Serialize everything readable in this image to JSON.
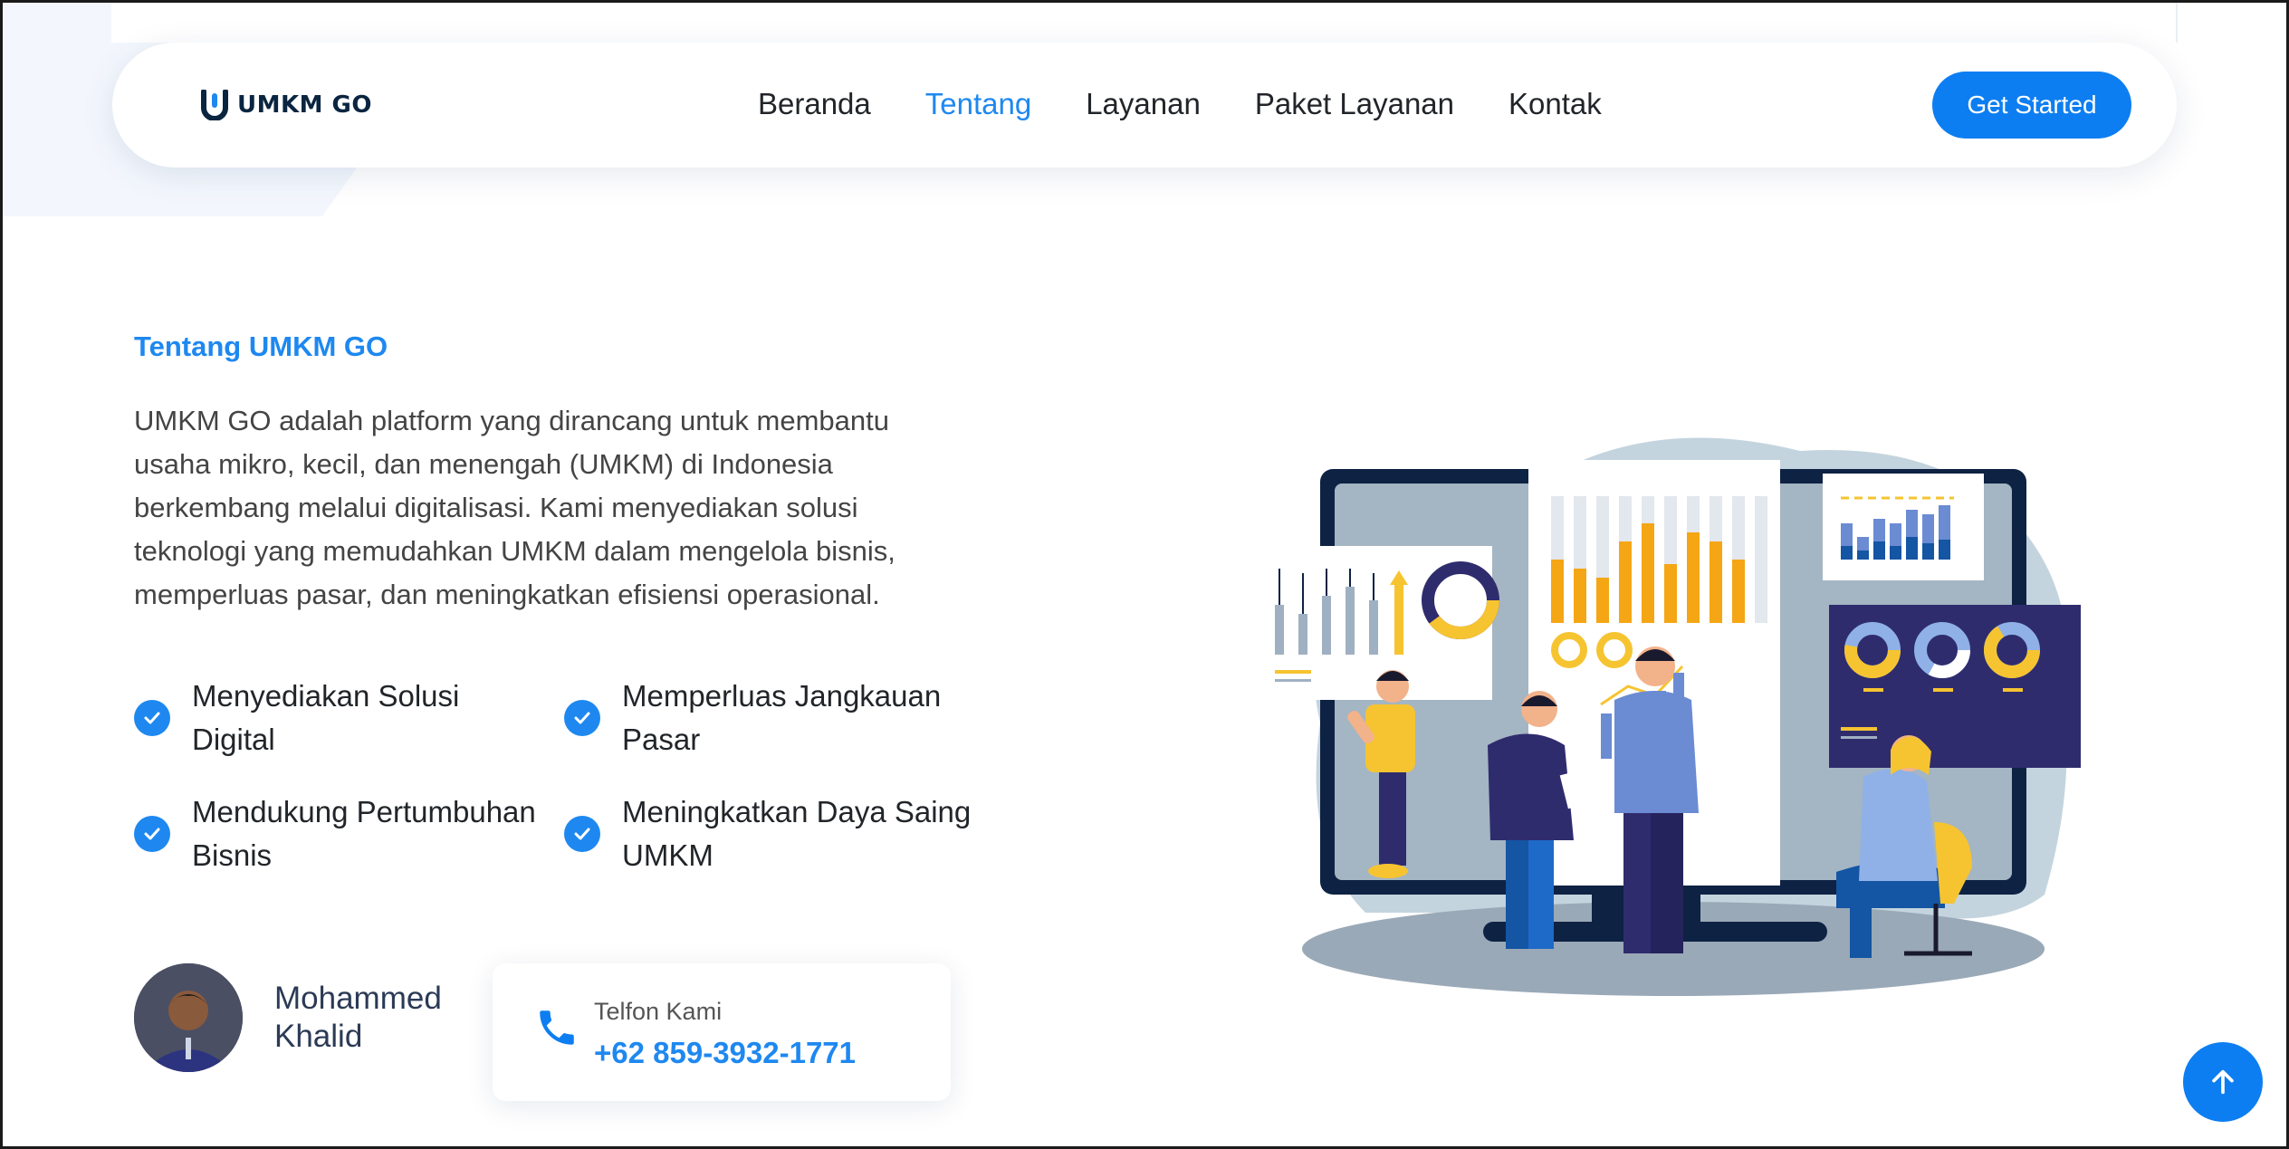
{
  "brand": {
    "name": "UMKM GO",
    "accent": "#1e88f0",
    "cta_color": "#0d7ef1"
  },
  "nav": {
    "items": [
      {
        "label": "Beranda",
        "active": false
      },
      {
        "label": "Tentang",
        "active": true
      },
      {
        "label": "Layanan",
        "active": false
      },
      {
        "label": "Paket Layanan",
        "active": false
      },
      {
        "label": "Kontak",
        "active": false
      }
    ],
    "cta_label": "Get Started"
  },
  "about": {
    "eyebrow": "Tentang UMKM GO",
    "description": "UMKM GO adalah platform yang dirancang untuk membantu usaha mikro, kecil, dan menengah (UMKM) di Indonesia berkembang melalui digitalisasi. Kami menyediakan solusi teknologi yang memudahkan UMKM dalam mengelola bisnis, memperluas pasar, dan meningkatkan efisiensi operasional.",
    "features": [
      {
        "label": "Menyediakan Solusi Digital",
        "icon": "check-circle-icon"
      },
      {
        "label": "Memperluas Jangkauan Pasar",
        "icon": "check-circle-icon"
      },
      {
        "label": "Mendukung Pertumbuhan Bisnis",
        "icon": "check-circle-icon"
      },
      {
        "label": "Meningkatkan Daya Saing UMKM",
        "icon": "check-circle-icon"
      }
    ]
  },
  "profile": {
    "name": "Mohammed Khalid"
  },
  "contact": {
    "label": "Telfon Kami",
    "phone": "+62 859-3932-1771",
    "icon": "phone-icon"
  },
  "scroll_top": {
    "icon": "arrow-up-icon"
  }
}
